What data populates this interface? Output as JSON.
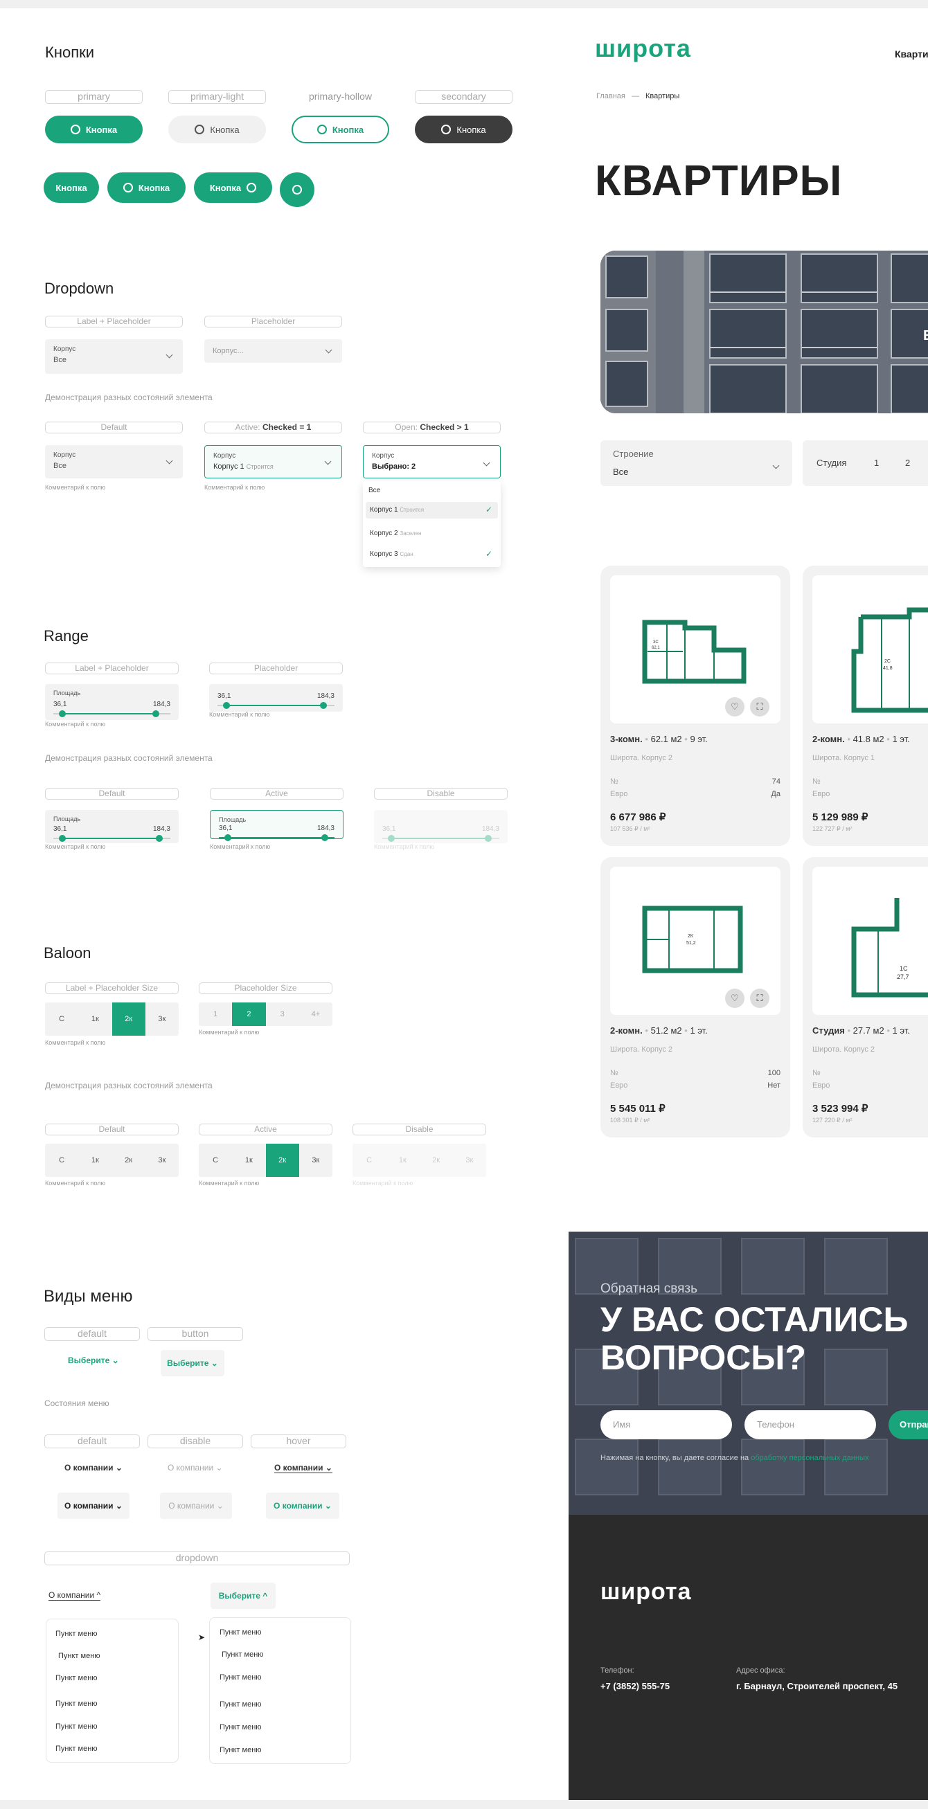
{
  "buttons": {
    "title": "Кнопки",
    "tags": [
      "primary",
      "primary-light",
      "primary-hollow",
      "secondary"
    ],
    "label": "Кнопка"
  },
  "dropdown": {
    "title": "Dropdown",
    "tags": [
      "Label + Placeholder",
      "Placeholder"
    ],
    "field_label": "Корпус",
    "field_value": "Все",
    "placeholder": "Корпус...",
    "demo_caption": "Демонстрация разных состояний элемента",
    "states": {
      "default": "Default",
      "active_prefix": "Active:",
      "active_bold": "Checked = 1",
      "open_prefix": "Open:",
      "open_bold": "Checked > 1"
    },
    "active_value": "Корпус 1",
    "active_suffix": "Строится",
    "open_value": "Выбрано: 2",
    "comment": "Комментарий к полю",
    "options": [
      {
        "label": "Все",
        "status": "",
        "checked": false
      },
      {
        "label": "Корпус 1",
        "status": "Строится",
        "checked": true
      },
      {
        "label": "Корпус 2",
        "status": "Заселен",
        "checked": false
      },
      {
        "label": "Корпус 3",
        "status": "Сдан",
        "checked": true
      }
    ]
  },
  "range": {
    "title": "Range",
    "tags": [
      "Label + Placeholder",
      "Placeholder"
    ],
    "label": "Площадь",
    "min": "36,1",
    "max": "184,3",
    "comment": "Комментарий к полю",
    "demo_caption": "Демонстрация разных состояний элемента",
    "states": [
      "Default",
      "Active",
      "Disable"
    ]
  },
  "baloon": {
    "title": "Baloon",
    "tags": [
      "Label + Placeholder Size",
      "Placeholder Size"
    ],
    "sizes": [
      "С",
      "1к",
      "2к",
      "3к"
    ],
    "floors": [
      "1",
      "2",
      "3",
      "4+"
    ],
    "comment": "Комментарий к полю",
    "demo_caption": "Демонстрация разных состояний элемента",
    "states": [
      "Default",
      "Active",
      "Disable"
    ]
  },
  "menus": {
    "title": "Виды меню",
    "tags": [
      "default",
      "button"
    ],
    "choose": "Выберите",
    "states_caption": "Состояния меню",
    "state_tags": [
      "default",
      "disable",
      "hover"
    ],
    "about": "О компании",
    "dropdown_tag": "dropdown",
    "item": "Пункт меню"
  },
  "site": {
    "logo": "широта",
    "nav_cut": "Кварти",
    "crumbs": [
      "Главная",
      "—",
      "Квартиры"
    ],
    "heading": "КВАРТИРЫ",
    "filter_label": "Строение",
    "filter_value": "Все",
    "rooms": [
      "Студия",
      "1",
      "2"
    ],
    "hero_letter": "Е",
    "cards": [
      {
        "rooms": "3-комн.",
        "area": "62.1 м2",
        "floor": "9 эт.",
        "building": "Широта. Корпус 2",
        "num_label": "№",
        "num": "74",
        "euro_label": "Евро",
        "euro": "Да",
        "price": "6 677 986 ₽",
        "ppm": "107 536 ₽ / м²",
        "plan_a": "3С",
        "plan_b": "62,1"
      },
      {
        "rooms": "2-комн.",
        "area": "41.8 м2",
        "floor": "1 эт.",
        "building": "Широта. Корпус 1",
        "num_label": "№",
        "num": "",
        "euro_label": "Евро",
        "euro": "",
        "price": "5 129 989 ₽",
        "ppm": "122 727 ₽ / м²",
        "plan_a": "2С",
        "plan_b": "41,8"
      },
      {
        "rooms": "2-комн.",
        "area": "51.2 м2",
        "floor": "1 эт.",
        "building": "Широта. Корпус 2",
        "num_label": "№",
        "num": "100",
        "euro_label": "Евро",
        "euro": "Нет",
        "price": "5 545 011 ₽",
        "ppm": "108 301 ₽ / м²",
        "plan_a": "2К",
        "plan_b": "51,2"
      },
      {
        "rooms": "Студия",
        "area": "27.7 м2",
        "floor": "1 эт.",
        "building": "Широта. Корпус 2",
        "num_label": "№",
        "num": "",
        "euro_label": "Евро",
        "euro": "",
        "price": "3 523 994 ₽",
        "ppm": "127 220 ₽ / м²",
        "plan_a": "1С",
        "plan_b": "27,7"
      }
    ],
    "feedback": {
      "kicker": "Обратная связь",
      "line1": "У ВАС ОСТАЛИСЬ",
      "line2": "ВОПРОСЫ?",
      "name_ph": "Имя",
      "phone_ph": "Телефон",
      "send": "Отправ",
      "consent": "Нажимая на кнопку, вы даете согласие на",
      "consent_link": "обработку персональных данных"
    },
    "footer": {
      "phone_label": "Телефон:",
      "phone": "+7 (3852) 555-75",
      "addr_label": "Адрес офиса:",
      "addr": "г. Барнаул, Строителей проспект, 45"
    }
  },
  "colors": {
    "accent": "#1aa47c",
    "dark": "#3d3d3d",
    "footer": "#2b2b2b"
  }
}
